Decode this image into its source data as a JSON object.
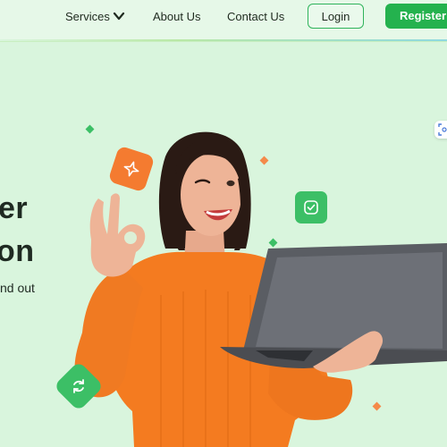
{
  "nav": {
    "services": "Services",
    "about": "About Us",
    "contact": "Contact Us",
    "login": "Login",
    "register": "Register"
  },
  "hero": {
    "line1": "er",
    "line2": "on",
    "sub": "nd out"
  },
  "colors": {
    "background": "#d9f5dd",
    "brand_green": "#24b24e",
    "accent_orange": "#f47b30",
    "text_dark": "#1f2a22"
  },
  "icons": {
    "services_chevron": "chevron-down-icon",
    "orange_badge": "sparkle-icon",
    "green_badge_right": "check-box-icon",
    "green_badge_left": "sync-icon",
    "edge_icon": "scan-icon"
  }
}
